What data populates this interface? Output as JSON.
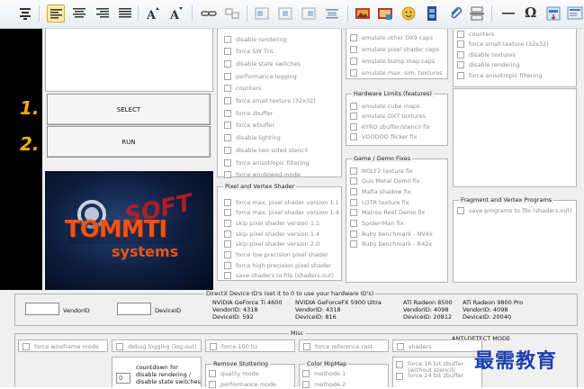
{
  "toolbar": {
    "icons": [
      "format-painter-icon",
      "align-left-icon",
      "align-center-icon",
      "align-right-icon",
      "align-justify-icon",
      "font-bigger-icon",
      "font-smaller-icon",
      "link-icon",
      "unlink-icon",
      "indent-left-icon",
      "indent-center-icon",
      "indent-right-icon",
      "indent-bottom-icon",
      "image-icon",
      "insert-image-icon",
      "emoticon-icon",
      "film-icon",
      "attachment-icon",
      "page-break-icon",
      "horizontal-line-icon",
      "omega-icon",
      "insert-object-icon",
      "preview-icon"
    ],
    "omega_glyph": "Ω"
  },
  "sidebar": {
    "step1": "1.",
    "step2": "2."
  },
  "buttons": {
    "select": "SELECT",
    "run": "RUN"
  },
  "logo": {
    "brand": "TOMMTI",
    "sub": "systems",
    "stamp": "SOFT"
  },
  "col1": {
    "items": [
      "disable rendering",
      "force SW TnL",
      "disable state switches",
      "performance logging",
      "counters",
      "force small texture (32x32)",
      "force zbuffer",
      "force wbuffer",
      "disable lighting",
      "disable two sided stencil",
      "force anisotropic filtering",
      "force windowed mode"
    ]
  },
  "pixel_shader": {
    "legend": "Pixel and Vertex Shader",
    "items": [
      "force max. pixel shader version 1.1",
      "force max. pixel shader version 1.4",
      "skip pixel shader version 1.1",
      "skip pixel shader version 1.4",
      "skip pixel shader version 2.0",
      "force low precision pixel shader",
      "force high precision pixel shader",
      "save shaders to file (shaders.out)"
    ]
  },
  "col2_top": {
    "items": [
      "emulate other DX9 caps",
      "emulate pixel shader caps",
      "emulate bump map caps",
      "emulate max. sim. textures"
    ]
  },
  "hw_limits": {
    "legend": "Hardware Limits (features)",
    "items": [
      "emulate cube maps",
      "emulate DXT textures",
      "KYRO zbuffer/stencil fix",
      "VOODOO flicker fix"
    ]
  },
  "game_fixes": {
    "legend": "Game / Demo Fixes",
    "items": [
      "NOLF2 texture fix",
      "Gun Metal Demo fix",
      "Mafia shadow fix",
      "LOTR texture fix",
      "Matrox Reef Demo fix",
      "Spider-Man fix",
      "Ruby benchmark - NV4x",
      "Ruby benchmark - R42x"
    ]
  },
  "col3_top": {
    "items": [
      "counters",
      "force small texture (32x32)",
      "disable textures",
      "disable rendering",
      "force anisotropic filtering"
    ]
  },
  "fragment": {
    "legend": "Fragment and Vertex Programs",
    "items": [
      "save programs to file (shaders.out)"
    ]
  },
  "device_ids": {
    "legend": "DirectX Device ID's (set it to 0 to use your hardware ID's)",
    "vendor_label": "VendorID",
    "device_label": "DeviceID",
    "cards": [
      {
        "name": "NVIDIA GeForce Ti 4600",
        "vendor": "VendorID: 4318",
        "device": "DeviceID: 592"
      },
      {
        "name": "NVIDIA GeForceFX 5900 Ultra",
        "vendor": "VendorID: 4318",
        "device": "DeviceID: 816"
      },
      {
        "name": "ATi Radeon 8500",
        "vendor": "VendorID: 4098",
        "device": "DeviceID: 20812"
      },
      {
        "name": "ATi Radeon 9800 Pro",
        "vendor": "VendorID: 4098",
        "device": "DeviceID: 20040"
      }
    ]
  },
  "misc": {
    "legend": "Misc",
    "anti_detect": "ANTI-DETECT MODE",
    "row1": [
      "force wireframe mode",
      "debug logging (log.out)",
      "force 100 hz",
      "force reference rast.",
      "shaders"
    ],
    "countdown_value": "0",
    "countdown_label": "countdown for disable rendering / disable state switches",
    "remove_stuttering": {
      "legend": "Remove Stuttering",
      "items": [
        "quality mode",
        "performance mode"
      ]
    },
    "color_mipmap": {
      "legend": "Color MipMap",
      "items": [
        "methode 1",
        "methode 2"
      ]
    },
    "zbuffer": [
      "force 16 bit zbuffer (without stencil)",
      "force 24 bit zbuffer"
    ]
  },
  "watermark": "最需教育"
}
